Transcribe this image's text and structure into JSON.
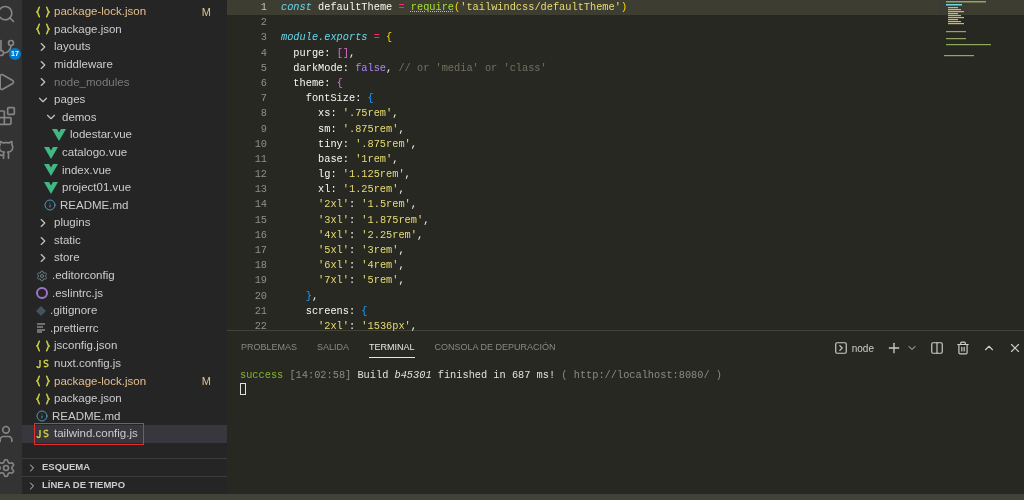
{
  "activity_bar": {
    "source_control_badge": "17"
  },
  "explorer": {
    "items": [
      {
        "kind": "json",
        "name": "package-lock.json",
        "badge": "M",
        "selected": false,
        "ignored": false,
        "annotated": false
      },
      {
        "kind": "json",
        "name": "package.json",
        "selected": false,
        "ignored": false,
        "annotated": false
      },
      {
        "kind": "folder",
        "name": "layouts",
        "expanded": false,
        "selected": false,
        "ignored": false,
        "annotated": false
      },
      {
        "kind": "folder",
        "name": "middleware",
        "expanded": false,
        "selected": false,
        "ignored": false,
        "annotated": false
      },
      {
        "kind": "folder",
        "name": "node_modules",
        "expanded": false,
        "selected": false,
        "ignored": true,
        "annotated": false
      },
      {
        "kind": "folder",
        "name": "pages",
        "expanded": true,
        "selected": false,
        "ignored": false,
        "annotated": false,
        "children": [
          {
            "kind": "folder",
            "name": "demos",
            "expanded": true,
            "selected": false,
            "ignored": false,
            "annotated": false,
            "children": [
              {
                "kind": "vue",
                "name": "lodestar.vue",
                "selected": false,
                "ignored": false,
                "annotated": false
              }
            ]
          },
          {
            "kind": "vue",
            "name": "catalogo.vue",
            "selected": false,
            "ignored": false,
            "annotated": false
          },
          {
            "kind": "vue",
            "name": "index.vue",
            "selected": false,
            "ignored": false,
            "annotated": false
          },
          {
            "kind": "vue",
            "name": "project01.vue",
            "selected": false,
            "ignored": false,
            "annotated": false
          },
          {
            "kind": "info",
            "name": "README.md",
            "selected": false,
            "ignored": false,
            "annotated": false
          }
        ]
      },
      {
        "kind": "folder",
        "name": "plugins",
        "expanded": false,
        "selected": false,
        "ignored": false,
        "annotated": false
      },
      {
        "kind": "folder",
        "name": "static",
        "expanded": false,
        "selected": false,
        "ignored": false,
        "annotated": false
      },
      {
        "kind": "folder",
        "name": "store",
        "expanded": false,
        "selected": false,
        "ignored": false,
        "annotated": false
      },
      {
        "kind": "config",
        "name": ".editorconfig",
        "selected": false,
        "ignored": false,
        "annotated": false
      },
      {
        "kind": "eslint",
        "name": ".eslintrc.js",
        "selected": false,
        "ignored": false,
        "annotated": false
      },
      {
        "kind": "git",
        "name": ".gitignore",
        "selected": false,
        "ignored": false,
        "annotated": false
      },
      {
        "kind": "text",
        "name": ".prettierrc",
        "selected": false,
        "ignored": false,
        "annotated": false
      },
      {
        "kind": "json",
        "name": "jsconfig.json",
        "selected": false,
        "ignored": false,
        "annotated": false
      },
      {
        "kind": "js",
        "name": "nuxt.config.js",
        "selected": false,
        "ignored": false,
        "annotated": false
      },
      {
        "kind": "json",
        "name": "package-lock.json",
        "badge": "M",
        "selected": false,
        "ignored": false,
        "annotated": false
      },
      {
        "kind": "json",
        "name": "package.json",
        "selected": false,
        "ignored": false,
        "annotated": false
      },
      {
        "kind": "info",
        "name": "README.md",
        "selected": false,
        "ignored": false,
        "annotated": false
      },
      {
        "kind": "js",
        "name": "tailwind.config.js",
        "selected": true,
        "ignored": false,
        "annotated": true
      }
    ],
    "sections": [
      {
        "title": "ESQUEMA",
        "expanded": false
      },
      {
        "title": "LÍNEA DE TIEMPO",
        "expanded": false
      }
    ]
  },
  "editor": {
    "lines": [
      {
        "number": "1",
        "current": true,
        "tokens": [
          {
            "text": "const",
            "kind": "kw"
          },
          {
            "text": " defaultTheme ",
            "kind": "plain"
          },
          {
            "text": "= ",
            "kind": "op"
          },
          {
            "text": "require",
            "kind": "fn"
          },
          {
            "text": "(",
            "kind": "b1"
          },
          {
            "text": "'tailwindcss/defaultTheme'",
            "kind": "str"
          },
          {
            "text": ")",
            "kind": "b1"
          }
        ]
      },
      {
        "number": "2",
        "current": false
      },
      {
        "number": "3",
        "current": false,
        "tokens": [
          {
            "text": "module.exports",
            "kind": "kw"
          },
          {
            "text": " = ",
            "kind": "op"
          },
          {
            "text": "{",
            "kind": "b1"
          }
        ]
      },
      {
        "number": "4",
        "current": false,
        "tokens": [
          {
            "text": "  purge: ",
            "kind": "plain"
          },
          {
            "text": "[]",
            "kind": "b2"
          },
          {
            "text": ",",
            "kind": "plain"
          }
        ]
      },
      {
        "number": "5",
        "current": false,
        "tokens": [
          {
            "text": "  darkMode: ",
            "kind": "plain"
          },
          {
            "text": "false",
            "kind": "bool"
          },
          {
            "text": ",",
            "kind": "plain"
          },
          {
            "text": " // or 'media' or 'class'",
            "kind": "comment"
          }
        ]
      },
      {
        "number": "6",
        "current": false,
        "tokens": [
          {
            "text": "  theme: ",
            "kind": "plain"
          },
          {
            "text": "{",
            "kind": "b2"
          }
        ]
      },
      {
        "number": "7",
        "current": false,
        "tokens": [
          {
            "text": "    fontSize: ",
            "kind": "plain"
          },
          {
            "text": "{",
            "kind": "b3"
          }
        ]
      },
      {
        "number": "8",
        "current": false,
        "tokens": [
          {
            "text": "      xs: ",
            "kind": "plain"
          },
          {
            "text": "'.75rem'",
            "kind": "str"
          },
          {
            "text": ",",
            "kind": "plain"
          }
        ]
      },
      {
        "number": "9",
        "current": false,
        "tokens": [
          {
            "text": "      sm: ",
            "kind": "plain"
          },
          {
            "text": "'.875rem'",
            "kind": "str"
          },
          {
            "text": ",",
            "kind": "plain"
          }
        ]
      },
      {
        "number": "10",
        "current": false,
        "tokens": [
          {
            "text": "      tiny: ",
            "kind": "plain"
          },
          {
            "text": "'.875rem'",
            "kind": "str"
          },
          {
            "text": ",",
            "kind": "plain"
          }
        ]
      },
      {
        "number": "11",
        "current": false,
        "tokens": [
          {
            "text": "      base: ",
            "kind": "plain"
          },
          {
            "text": "'1rem'",
            "kind": "str"
          },
          {
            "text": ",",
            "kind": "plain"
          }
        ]
      },
      {
        "number": "12",
        "current": false,
        "tokens": [
          {
            "text": "      lg: ",
            "kind": "plain"
          },
          {
            "text": "'1.125rem'",
            "kind": "str"
          },
          {
            "text": ",",
            "kind": "plain"
          }
        ]
      },
      {
        "number": "13",
        "current": false,
        "tokens": [
          {
            "text": "      xl: ",
            "kind": "plain"
          },
          {
            "text": "'1.25rem'",
            "kind": "str"
          },
          {
            "text": ",",
            "kind": "plain"
          }
        ]
      },
      {
        "number": "14",
        "current": false,
        "tokens": [
          {
            "text": "      '2xl'",
            "kind": "str"
          },
          {
            "text": ": ",
            "kind": "plain"
          },
          {
            "text": "'1.5rem'",
            "kind": "str"
          },
          {
            "text": ",",
            "kind": "plain"
          }
        ]
      },
      {
        "number": "15",
        "current": false,
        "tokens": [
          {
            "text": "      '3xl'",
            "kind": "str"
          },
          {
            "text": ": ",
            "kind": "plain"
          },
          {
            "text": "'1.875rem'",
            "kind": "str"
          },
          {
            "text": ",",
            "kind": "plain"
          }
        ]
      },
      {
        "number": "16",
        "current": false,
        "tokens": [
          {
            "text": "      '4xl'",
            "kind": "str"
          },
          {
            "text": ": ",
            "kind": "plain"
          },
          {
            "text": "'2.25rem'",
            "kind": "str"
          },
          {
            "text": ",",
            "kind": "plain"
          }
        ]
      },
      {
        "number": "17",
        "current": false,
        "tokens": [
          {
            "text": "      '5xl'",
            "kind": "str"
          },
          {
            "text": ": ",
            "kind": "plain"
          },
          {
            "text": "'3rem'",
            "kind": "str"
          },
          {
            "text": ",",
            "kind": "plain"
          }
        ]
      },
      {
        "number": "18",
        "current": false,
        "tokens": [
          {
            "text": "      '6xl'",
            "kind": "str"
          },
          {
            "text": ": ",
            "kind": "plain"
          },
          {
            "text": "'4rem'",
            "kind": "str"
          },
          {
            "text": ",",
            "kind": "plain"
          }
        ]
      },
      {
        "number": "19",
        "current": false,
        "tokens": [
          {
            "text": "      '7xl'",
            "kind": "str"
          },
          {
            "text": ": ",
            "kind": "plain"
          },
          {
            "text": "'5rem'",
            "kind": "str"
          },
          {
            "text": ",",
            "kind": "plain"
          }
        ]
      },
      {
        "number": "20",
        "current": false,
        "tokens": [
          {
            "text": "    }",
            "kind": "b3"
          },
          {
            "text": ",",
            "kind": "plain"
          }
        ]
      },
      {
        "number": "21",
        "current": false,
        "tokens": [
          {
            "text": "    screens: ",
            "kind": "plain"
          },
          {
            "text": "{",
            "kind": "b3"
          }
        ]
      },
      {
        "number": "22",
        "current": false,
        "tokens": [
          {
            "text": "      '2xl'",
            "kind": "str"
          },
          {
            "text": ": ",
            "kind": "plain"
          },
          {
            "text": "'1536px'",
            "kind": "str"
          },
          {
            "text": ",",
            "kind": "plain"
          }
        ]
      }
    ]
  },
  "panel": {
    "tabs": [
      {
        "label": "PROBLEMAS",
        "selected": false
      },
      {
        "label": "SALIDA",
        "selected": false
      },
      {
        "label": "TERMINAL",
        "selected": true
      },
      {
        "label": "CONSOLA DE DEPURACIÓN",
        "selected": false
      }
    ],
    "terminal_name": "node",
    "output": [
      {
        "text": "success",
        "kind": "success"
      },
      {
        "text": " [14:02:58] ",
        "kind": "muted"
      },
      {
        "text": "Build ",
        "kind": "plain"
      },
      {
        "text": "b45301",
        "kind": "italic"
      },
      {
        "text": " finished in 687 ms! ",
        "kind": "plain"
      },
      {
        "text": "( http://localhost:8080/ )",
        "kind": "muted"
      }
    ]
  }
}
